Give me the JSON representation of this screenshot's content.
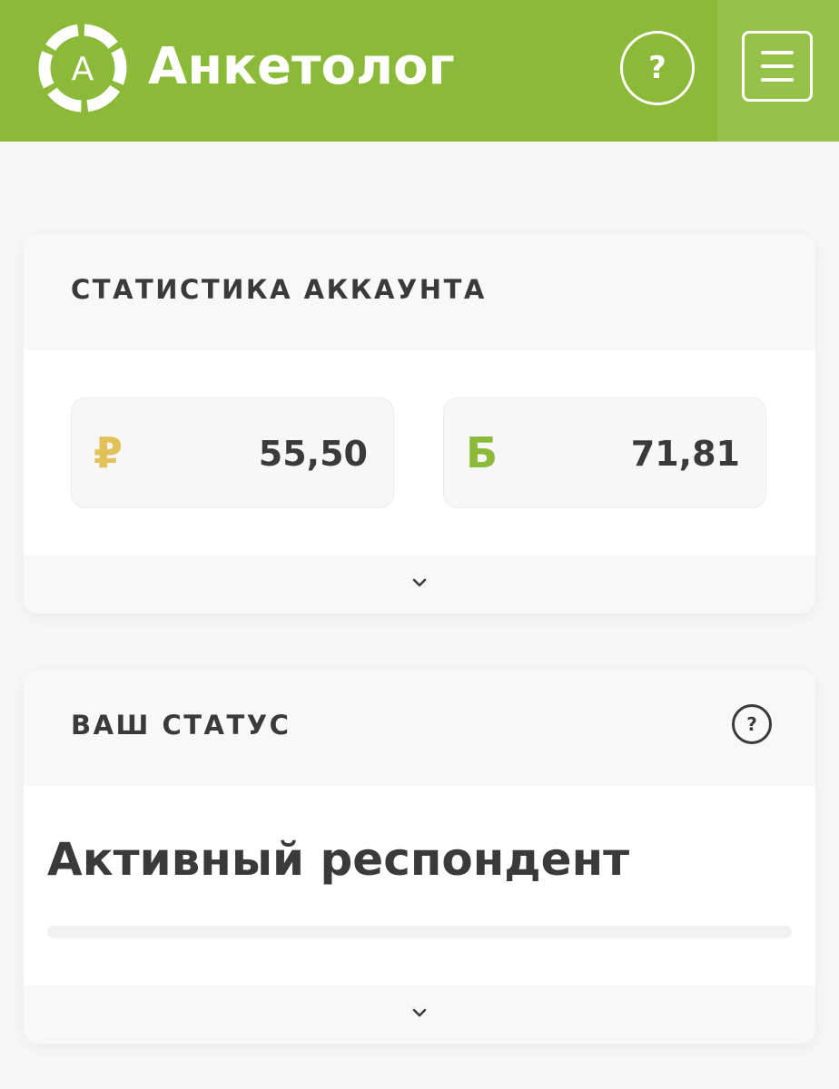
{
  "header": {
    "logo_letter": "A",
    "brand": "Анкетолог",
    "help_label": "?",
    "colors": {
      "bar": "#8bba38",
      "menu_bg": "#95c34a"
    },
    "icons": {
      "logo": "ring-logo-icon",
      "help": "question-circle-icon",
      "menu": "hamburger-icon"
    }
  },
  "stats": {
    "title": "СТАТИСТИКА АККАУНТА",
    "rub": {
      "symbol": "₽",
      "value": "55,50",
      "color": "#e3c15a"
    },
    "bonus": {
      "symbol": "Б",
      "value": "71,81",
      "color": "#8bba38"
    },
    "expand_icon": "chevron-down-icon"
  },
  "status": {
    "title": "ВАШ СТАТУС",
    "help_label": "?",
    "value": "Активный респондент",
    "progress": 0,
    "expand_icon": "chevron-down-icon"
  }
}
